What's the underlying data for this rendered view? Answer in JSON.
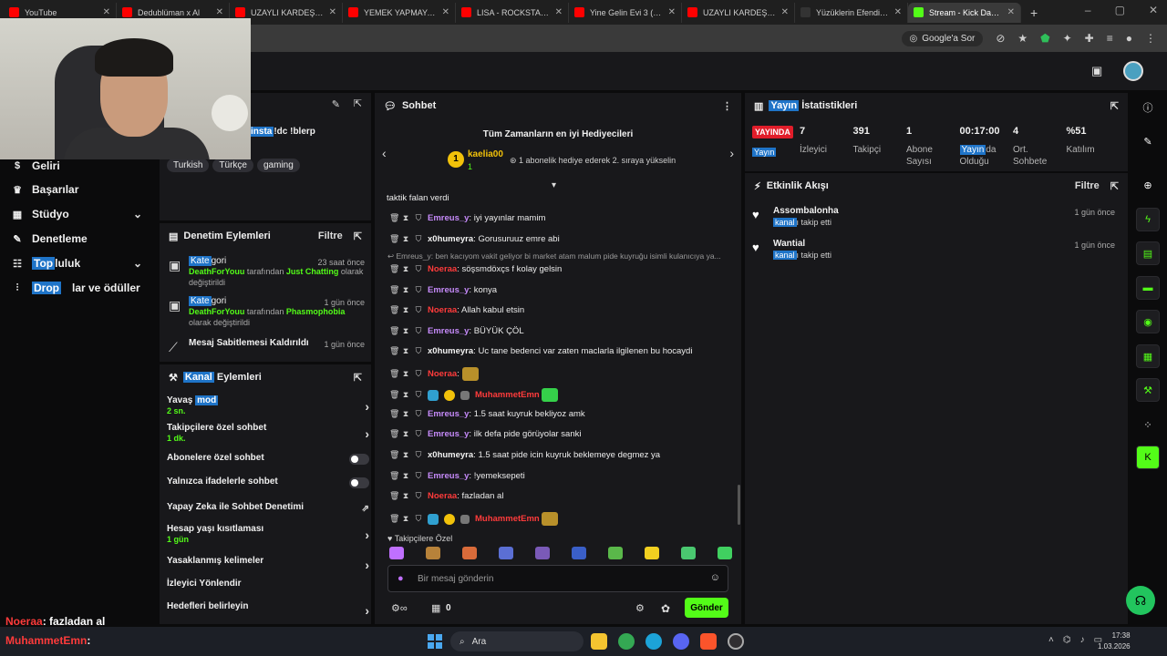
{
  "browser": {
    "tabs": [
      {
        "title": "YouTube",
        "color": "#ff0000"
      },
      {
        "title": "Dedublüman x Al",
        "color": "#ff0000"
      },
      {
        "title": "UZAYLI KARDEŞLERİ |",
        "color": "#ff0000"
      },
      {
        "title": "YEMEK YAPMAYA GE",
        "color": "#ff0000"
      },
      {
        "title": "LISA - ROCKSTAR (OF",
        "color": "#ff0000"
      },
      {
        "title": "Yine Gelin Evi 3 (214",
        "color": "#ff0000"
      },
      {
        "title": "UZAYLI KARDEŞLERİ |",
        "color": "#ff0000"
      },
      {
        "title": "Yüzüklerin Efendisi Y",
        "color": "#333333"
      },
      {
        "title": "Stream - Kick Dashb",
        "color": "#53fc18",
        "active": true
      }
    ],
    "google_ask": "Google'a Sor"
  },
  "stream_info": {
    "title_partial": "!dc !blerp",
    "highlight": "insta",
    "tags": [
      "Turkish",
      "Türkçe",
      "gaming"
    ]
  },
  "left_nav": {
    "items": [
      {
        "label": "Geliri",
        "icon": "money-icon",
        "chevron": false
      },
      {
        "label": "Başarılar",
        "icon": "trophy-icon",
        "chevron": false
      },
      {
        "label": "Stüdyo",
        "icon": "studio-icon",
        "chevron": true
      },
      {
        "label": "Denetleme",
        "icon": "wrench-icon",
        "chevron": false
      },
      {
        "label": "Topluluk",
        "icon": "community-icon",
        "chevron": true,
        "highlight": "Top"
      },
      {
        "label": "lar ve ödüller",
        "icon": "drops-icon",
        "chevron": false,
        "highlight": "Drop"
      }
    ]
  },
  "mod_actions": {
    "title": "Denetim Eylemleri",
    "filter": "Filtre",
    "events": [
      {
        "title": "Kategori",
        "highlight": "Kate",
        "user": "DeathForYouu",
        "middle": "tarafından",
        "target": "Just Chatting",
        "suffix": "olarak değiştirildi",
        "time": "23 saat önce"
      },
      {
        "title": "Kategori",
        "highlight": "Kate",
        "user": "DeathForYouu",
        "middle": "tarafından",
        "target": "Phasmophobia",
        "suffix": "olarak değiştirildi",
        "time": "1 gün önce"
      },
      {
        "title": "Mesaj Sabitlemesi Kaldırıldı",
        "time": "1 gün önce"
      }
    ]
  },
  "channel_actions": {
    "title_highlight": "Kanal",
    "title_rest": " Eylemleri",
    "rows": [
      {
        "label": "Yavaş ",
        "highlight": "mod",
        "sub": "2 sn.",
        "control": "arrow"
      },
      {
        "label": "Takipçilere özel sohbet",
        "sub": "1 dk.",
        "control": "arrow"
      },
      {
        "label": "Abonelere özel sohbet",
        "control": "toggle"
      },
      {
        "label": "Yalnızca ifadelerle sohbet",
        "control": "toggle"
      },
      {
        "label": "Yapay Zeka ile Sohbet Denetimi",
        "control": "external"
      },
      {
        "label": "Hesap yaşı kısıtlaması",
        "sub": "1 gün",
        "control": "arrow"
      },
      {
        "label": "Yasaklanmış kelimeler",
        "control": "arrow"
      },
      {
        "label": "İzleyici Yönlendir",
        "control": "none"
      },
      {
        "label": "Hedefleri belirleyin",
        "control": "arrow"
      }
    ]
  },
  "chat": {
    "title": "Sohbet",
    "top_gifters_title": "Tüm Zamanların en iyi Hediyecileri",
    "gifter_name": "kaelia00",
    "gifter_count": "1",
    "gifter_rank": "1",
    "gifter_hint": "1 abonelik hediye ederek 2. sıraya yükselin",
    "first_line": "taktik falan verdi",
    "reply_preview": "Emreus_y: ben kacıyom vakit geliyor bi market atam malum pide kuyruğu isimli kulanıcıya ya...",
    "messages": [
      {
        "user": "Emreus_y",
        "ucolor": "purple",
        "text": "iyi yayınlar mamim"
      },
      {
        "user": "x0humeyra",
        "ucolor": "white",
        "text": "Gorusuruuz emre abi"
      },
      {
        "user": "Noeraa",
        "ucolor": "red",
        "text": "söşsmdöxçs f kolay gelsin"
      },
      {
        "user": "Emreus_y",
        "ucolor": "purple",
        "text": "konya"
      },
      {
        "user": "Noeraa",
        "ucolor": "red",
        "text": "Allah kabul etsin"
      },
      {
        "user": "Emreus_y",
        "ucolor": "purple",
        "text": "BÜYÜK ÇÖL"
      },
      {
        "user": "x0humeyra",
        "ucolor": "white",
        "text": "Uc tane bedenci var zaten maclarla ilgilenen bu hocaydi"
      },
      {
        "user": "Noeraa",
        "ucolor": "red",
        "text": "",
        "emote": "#b8902a"
      },
      {
        "user": "MuhammetEmn",
        "ucolor": "red",
        "text": "",
        "emote": "#35d14a",
        "badges": true
      },
      {
        "user": "Emreus_y",
        "ucolor": "purple",
        "text": "1.5 saat kuyruk bekliyoz amk"
      },
      {
        "user": "Emreus_y",
        "ucolor": "purple",
        "text": "ilk defa pide görüyolar sanki"
      },
      {
        "user": "x0humeyra",
        "ucolor": "white",
        "text": "1.5 saat pide icin kuyruk beklemeye degmez ya"
      },
      {
        "user": "Emreus_y",
        "ucolor": "purple",
        "text": "!yemeksepeti"
      },
      {
        "user": "Noeraa",
        "ucolor": "red",
        "text": "fazladan al"
      },
      {
        "user": "MuhammetEmn",
        "ucolor": "red",
        "text": "",
        "emote": "#b8902a",
        "badges": true
      }
    ],
    "followers_only_label": "Takipçilere Özel",
    "emote_colors": [
      "#c070ff",
      "#b7823a",
      "#d96b3a",
      "#5b6fd4",
      "#7a5ab8",
      "#3a5fc8",
      "#5ab84a",
      "#f2d020",
      "#4ac870",
      "#40d060"
    ],
    "input_placeholder": "Bir mesaj gönderin",
    "points": "0",
    "send_label": "Gönder"
  },
  "stats": {
    "title_highlight": "Yayın",
    "title_rest": " İstatistikleri",
    "live_label": "YAYINDA",
    "live_sub": "Yayın",
    "items": [
      {
        "value": "7",
        "label": "İzleyici"
      },
      {
        "value": "391",
        "label": "Takipçi"
      },
      {
        "value": "1",
        "label": "Abone Sayısı"
      },
      {
        "value": "00:17:00",
        "label_highlight": "Yayın",
        "label": "da Olduğu"
      },
      {
        "value": "4",
        "label": "Ort. Sohbete"
      },
      {
        "value": "%51",
        "label": "Katılım"
      }
    ]
  },
  "activity": {
    "title": "Etkinlik Akışı",
    "filter": "Filtre",
    "events": [
      {
        "name": "Assombalonha",
        "hl": "kanal",
        "text": "ı takip etti",
        "time": "1 gün önce"
      },
      {
        "name": "Wantial",
        "hl": "kanal",
        "text": "ı takip etti",
        "time": "1 gün önce"
      }
    ]
  },
  "overlay_chat": {
    "line1_user": "Noeraa",
    "line1_text": ": fazladan al",
    "line2_user": "MuhammetEmn",
    "line2_sep": ":"
  },
  "taskbar": {
    "search": "Ara",
    "time": "17:38",
    "date": "1.03.2026"
  }
}
